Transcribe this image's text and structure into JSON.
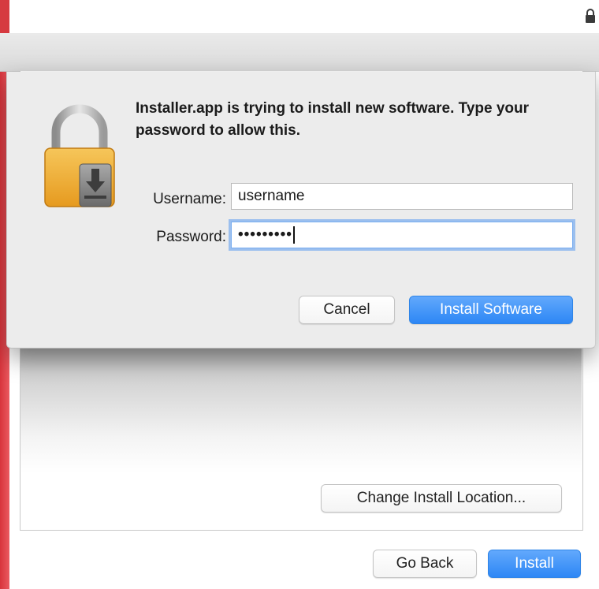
{
  "installer": {
    "change_location_label": "Change Install Location...",
    "go_back_label": "Go Back",
    "install_label": "Install"
  },
  "auth_dialog": {
    "message": "Installer.app is trying to install new software. Type your password to allow this.",
    "username_label": "Username:",
    "username_value": "username",
    "password_label": "Password:",
    "password_masked": "•••••••••",
    "cancel_label": "Cancel",
    "install_software_label": "Install Software"
  },
  "icons": {
    "menubar_lock": "lock-icon",
    "dialog_lock": "padlock-install-icon"
  },
  "colors": {
    "primary_button": "#2d87f5",
    "sidebar_red": "#d8343c",
    "dialog_background": "#ececec",
    "focus_ring": "#7aaef0"
  }
}
